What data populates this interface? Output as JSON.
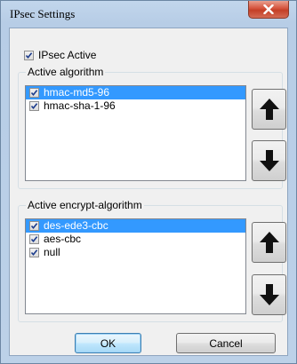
{
  "window": {
    "title": "IPsec Settings",
    "close_label": "X"
  },
  "ipsec_active": {
    "label": "IPsec Active",
    "checked": true
  },
  "active_algorithm": {
    "label": "Active algorithm",
    "items": [
      {
        "label": "hmac-md5-96",
        "checked": true,
        "selected": true
      },
      {
        "label": "hmac-sha-1-96",
        "checked": true,
        "selected": false
      }
    ]
  },
  "active_encrypt_algorithm": {
    "label": "Active encrypt-algorithm",
    "items": [
      {
        "label": "des-ede3-cbc",
        "checked": true,
        "selected": true
      },
      {
        "label": "aes-cbc",
        "checked": true,
        "selected": false
      },
      {
        "label": "null",
        "checked": true,
        "selected": false
      }
    ]
  },
  "buttons": {
    "ok": "OK",
    "cancel": "Cancel"
  },
  "colors": {
    "selection": "#3399ff",
    "title_bar": "#bcd1e8",
    "close_button": "#c43f26"
  },
  "icons": {
    "move_up": "arrow-up-icon",
    "move_down": "arrow-down-icon",
    "close": "close-icon"
  }
}
